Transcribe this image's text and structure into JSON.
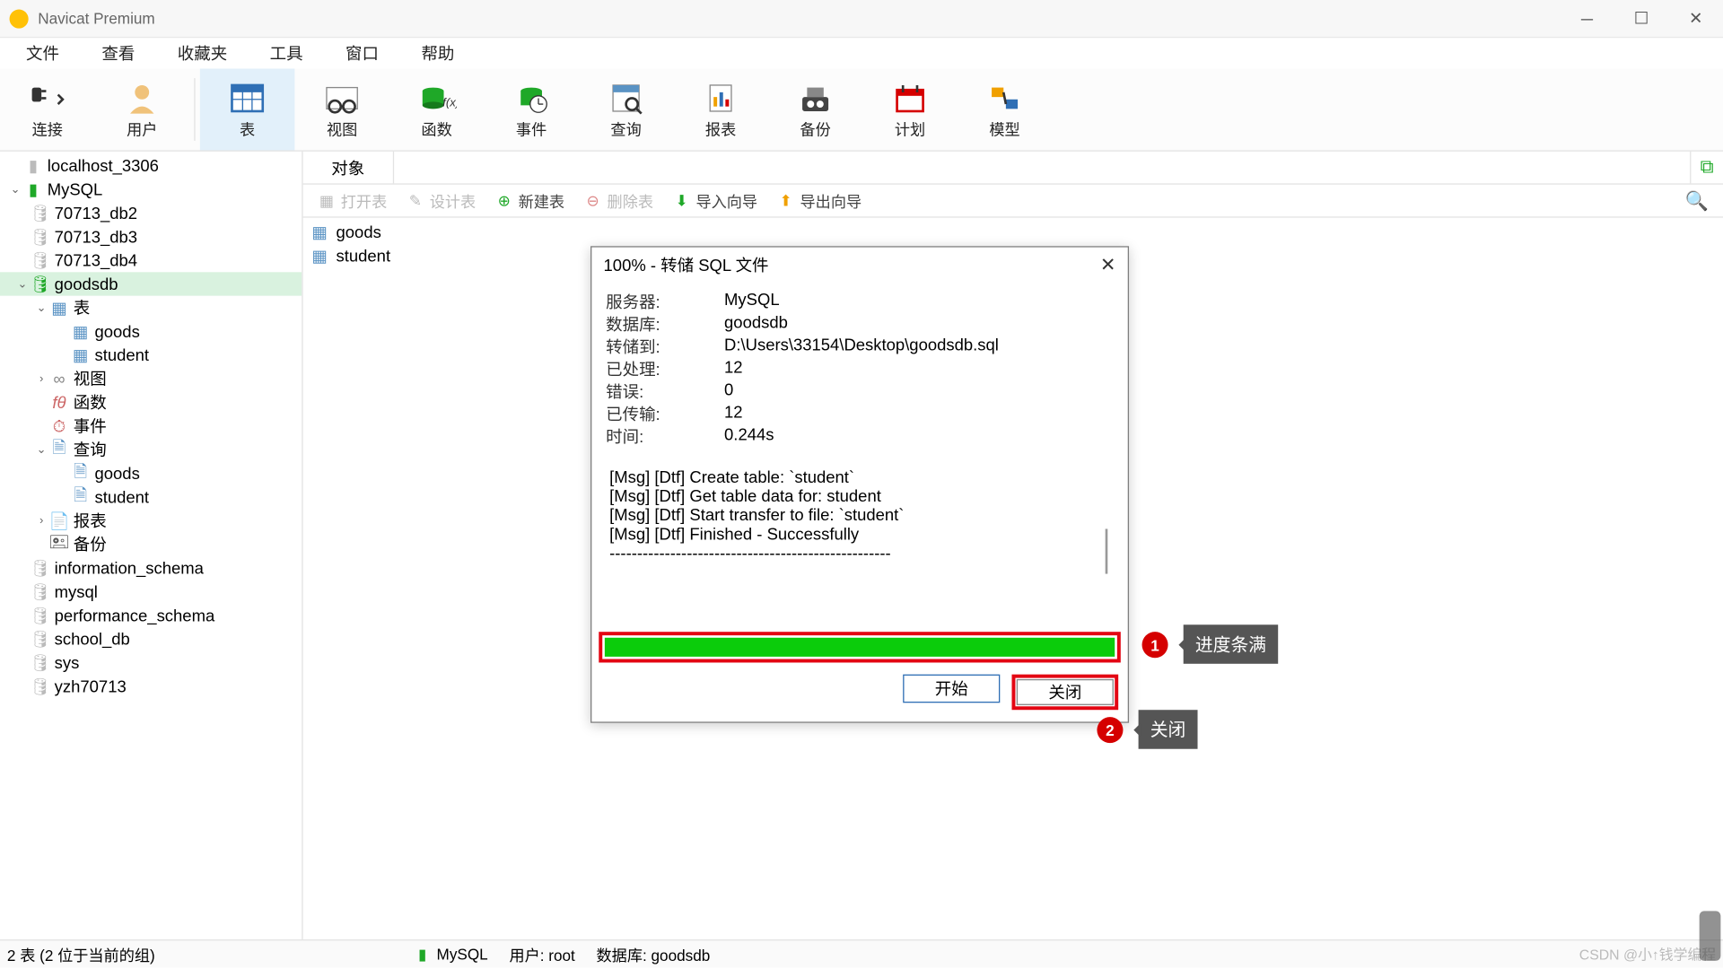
{
  "window": {
    "title": "Navicat Premium"
  },
  "menu": [
    "文件",
    "查看",
    "收藏夹",
    "工具",
    "窗口",
    "帮助"
  ],
  "toolbar": [
    {
      "name": "connect",
      "label": "连接",
      "has_dropdown": true
    },
    {
      "name": "user",
      "label": "用户"
    },
    {
      "name": "table",
      "label": "表",
      "selected": true
    },
    {
      "name": "view",
      "label": "视图"
    },
    {
      "name": "function",
      "label": "函数"
    },
    {
      "name": "event",
      "label": "事件"
    },
    {
      "name": "query",
      "label": "查询"
    },
    {
      "name": "report",
      "label": "报表"
    },
    {
      "name": "backup",
      "label": "备份"
    },
    {
      "name": "schedule",
      "label": "计划"
    },
    {
      "name": "model",
      "label": "模型"
    }
  ],
  "tree": {
    "items": [
      {
        "name": "localhost_3306",
        "type": "conn-off",
        "depth": 0
      },
      {
        "name": "MySQL",
        "type": "conn-on",
        "depth": 0,
        "expanded": true,
        "children": [
          {
            "name": "70713_db2",
            "type": "db-off",
            "depth": 1
          },
          {
            "name": "70713_db3",
            "type": "db-off",
            "depth": 1
          },
          {
            "name": "70713_db4",
            "type": "db-off",
            "depth": 1
          },
          {
            "name": "goodsdb",
            "type": "db-on",
            "depth": 1,
            "expanded": true,
            "selected": true,
            "children": [
              {
                "name": "表",
                "type": "folder-table",
                "depth": 2,
                "expanded": true,
                "children": [
                  {
                    "name": "goods",
                    "type": "table",
                    "depth": 3
                  },
                  {
                    "name": "student",
                    "type": "table",
                    "depth": 3
                  }
                ]
              },
              {
                "name": "视图",
                "type": "folder-view",
                "depth": 2,
                "collapsed": true
              },
              {
                "name": "函数",
                "type": "folder-func",
                "depth": 2
              },
              {
                "name": "事件",
                "type": "folder-event",
                "depth": 2
              },
              {
                "name": "查询",
                "type": "folder-query",
                "depth": 2,
                "expanded": true,
                "children": [
                  {
                    "name": "goods",
                    "type": "query",
                    "depth": 3
                  },
                  {
                    "name": "student",
                    "type": "query",
                    "depth": 3
                  }
                ]
              },
              {
                "name": "报表",
                "type": "folder-report",
                "depth": 2,
                "collapsed": true
              },
              {
                "name": "备份",
                "type": "folder-backup",
                "depth": 2
              }
            ]
          },
          {
            "name": "information_schema",
            "type": "db-off",
            "depth": 1
          },
          {
            "name": "mysql",
            "type": "db-off",
            "depth": 1
          },
          {
            "name": "performance_schema",
            "type": "db-off",
            "depth": 1
          },
          {
            "name": "school_db",
            "type": "db-off",
            "depth": 1
          },
          {
            "name": "sys",
            "type": "db-off",
            "depth": 1
          },
          {
            "name": "yzh70713",
            "type": "db-off",
            "depth": 1
          }
        ]
      }
    ]
  },
  "main": {
    "tab_label": "对象",
    "subtoolbar": {
      "open": "打开表",
      "design": "设计表",
      "new": "新建表",
      "delete": "删除表",
      "import": "导入向导",
      "export": "导出向导"
    },
    "objects": [
      "goods",
      "student"
    ]
  },
  "dialog": {
    "title": "100% - 转储 SQL 文件",
    "fields": {
      "server_k": "服务器:",
      "server_v": "MySQL",
      "db_k": "数据库:",
      "db_v": "goodsdb",
      "path_k": "转储到:",
      "path_v": "D:\\Users\\33154\\Desktop\\goodsdb.sql",
      "proc_k": "已处理:",
      "proc_v": "12",
      "err_k": "错误:",
      "err_v": "0",
      "sent_k": "已传输:",
      "sent_v": "12",
      "time_k": "时间:",
      "time_v": "0.244s"
    },
    "log": [
      "[Msg] [Dtf] Create table: `student`",
      "[Msg] [Dtf] Get table data for: student",
      "[Msg] [Dtf] Start transfer to file: `student`",
      "[Msg] [Dtf] Finished - Successfully",
      "---------------------------------------------------"
    ],
    "progress_percent": 100,
    "btn_start": "开始",
    "btn_close": "关闭"
  },
  "annotations": {
    "a1_num": "1",
    "a1_text": "进度条满",
    "a2_num": "2",
    "a2_text": "关闭"
  },
  "status": {
    "count_text": "2 表 (2 位于当前的组)",
    "conn": "MySQL",
    "user_label": "用户: root",
    "db_label": "数据库: goodsdb",
    "watermark": "CSDN @小↑钱学编程"
  },
  "colors": {
    "accent_green": "#1fa828",
    "select_bg": "#d9f2df",
    "annot_red": "#d50000",
    "highlight_red": "#e30613"
  }
}
